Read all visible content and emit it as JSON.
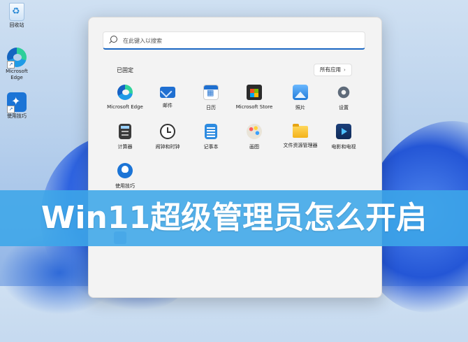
{
  "desktop": {
    "icons": [
      {
        "label": "回收站"
      },
      {
        "label": "Microsoft Edge"
      },
      {
        "label": "使用技巧"
      }
    ]
  },
  "start_menu": {
    "search": {
      "placeholder": "在此键入以搜索"
    },
    "pinned_title": "已固定",
    "all_apps_label": "所有应用",
    "apps": [
      {
        "label": "Microsoft Edge",
        "icon": "edge-icon"
      },
      {
        "label": "邮件",
        "icon": "mail-icon"
      },
      {
        "label": "日历",
        "icon": "calendar-icon"
      },
      {
        "label": "Microsoft Store",
        "icon": "store-icon"
      },
      {
        "label": "照片",
        "icon": "photos-icon"
      },
      {
        "label": "设置",
        "icon": "gear-icon"
      },
      {
        "label": "计算器",
        "icon": "calculator-icon"
      },
      {
        "label": "闹钟和时钟",
        "icon": "clock-icon"
      },
      {
        "label": "记事本",
        "icon": "notepad-icon"
      },
      {
        "label": "画图",
        "icon": "paint-icon"
      },
      {
        "label": "文件资源管理器",
        "icon": "folder-icon"
      },
      {
        "label": "电影和电视",
        "icon": "movie-icon"
      },
      {
        "label": "使用技巧",
        "icon": "tips-icon"
      }
    ]
  },
  "banner": {
    "title": "Win11超级管理员怎么开启"
  },
  "colors": {
    "accent": "#1a67c3",
    "banner": "#3ca6e8"
  }
}
